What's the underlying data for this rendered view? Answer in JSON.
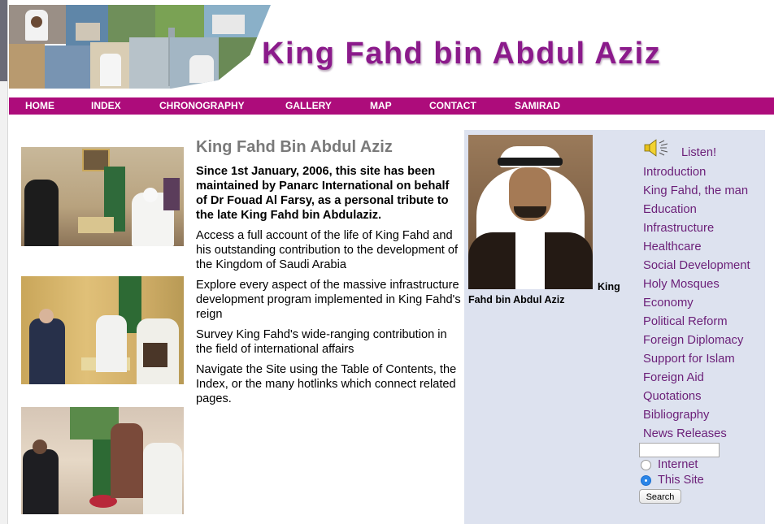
{
  "site": {
    "title": "King Fahd bin Abdul Aziz"
  },
  "nav": {
    "items": [
      {
        "label": "HOME"
      },
      {
        "label": "INDEX"
      },
      {
        "label": "CHRONOGRAPHY"
      },
      {
        "label": "GALLERY"
      },
      {
        "label": "MAP"
      },
      {
        "label": "CONTACT"
      },
      {
        "label": "SAMIRAD"
      }
    ]
  },
  "article": {
    "heading": "King Fahd Bin Abdul Aziz",
    "lead": "Since 1st January, 2006, this site has been maintained by Panarc International on behalf of Dr Fouad Al Farsy, as a personal tribute to the late King Fahd bin Abdulaziz.",
    "paragraphs": [
      "Access a full account of the life of King Fahd and his outstanding contribution to the development of the Kingdom of Saudi Arabia",
      "Explore every aspect of the massive infrastructure development program implemented in King Fahd's reign",
      "Survey King Fahd's wide-ranging contribution in the field of international affairs",
      "Navigate the Site using the Table of Contents, the Index, or the many hotlinks which connect related pages."
    ]
  },
  "portrait": {
    "caption_line1": "King",
    "caption_line2": "Fahd bin Abdul Aziz"
  },
  "listen": {
    "label": "Listen!",
    "icon": "speaker-icon"
  },
  "menu": {
    "items": [
      "Introduction",
      "King Fahd, the man",
      "Education",
      "Infrastructure",
      "Healthcare",
      "Social Development",
      "Holy Mosques",
      "Economy",
      "Political Reform",
      "Foreign Diplomacy",
      "Support for Islam",
      "Foreign Aid",
      "Quotations",
      "Bibliography",
      "News Releases"
    ]
  },
  "search": {
    "input_value": "",
    "option_internet": "Internet",
    "option_site": "This Site",
    "selected": "This Site",
    "button_label": "Search"
  },
  "colors": {
    "title": "#8b1a8b",
    "nav_bg": "#ad0c7b",
    "menu_link": "#6b1f78",
    "panel_bg": "#dde2ef",
    "heading_gray": "#7a7a7a"
  }
}
